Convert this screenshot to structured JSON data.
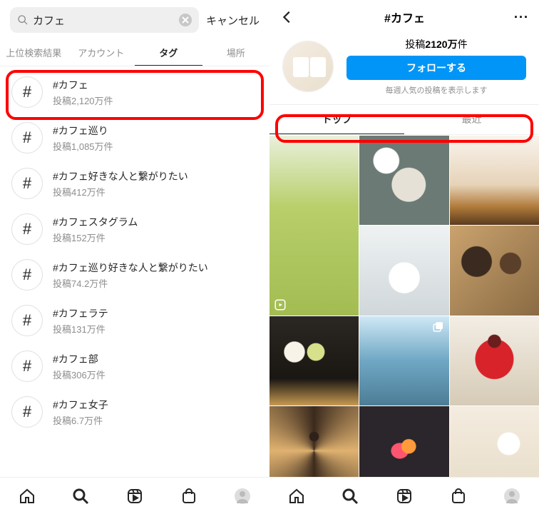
{
  "left": {
    "search_query": "カフェ",
    "cancel_label": "キャンセル",
    "tabs": [
      "上位検索結果",
      "アカウント",
      "タグ",
      "場所"
    ],
    "active_tab_index": 2,
    "results": [
      {
        "name": "#カフェ",
        "sub": "投稿2,120万件"
      },
      {
        "name": "#カフェ巡り",
        "sub": "投稿1,085万件"
      },
      {
        "name": "#カフェ好きな人と繋がりたい",
        "sub": "投稿412万件"
      },
      {
        "name": "#カフェスタグラム",
        "sub": "投稿152万件"
      },
      {
        "name": "#カフェ巡り好きな人と繋がりたい",
        "sub": "投稿74.2万件"
      },
      {
        "name": "#カフェラテ",
        "sub": "投稿131万件"
      },
      {
        "name": "#カフェ部",
        "sub": "投稿306万件"
      },
      {
        "name": "#カフェ女子",
        "sub": "投稿6.7万件"
      }
    ]
  },
  "right": {
    "title": "#カフェ",
    "post_prefix": "投稿",
    "post_count": "2120万",
    "post_suffix": "件",
    "follow_label": "フォローする",
    "note": "毎週人気の投稿を表示します",
    "subtabs": [
      "トップ",
      "最近"
    ],
    "active_subtab_index": 0
  }
}
